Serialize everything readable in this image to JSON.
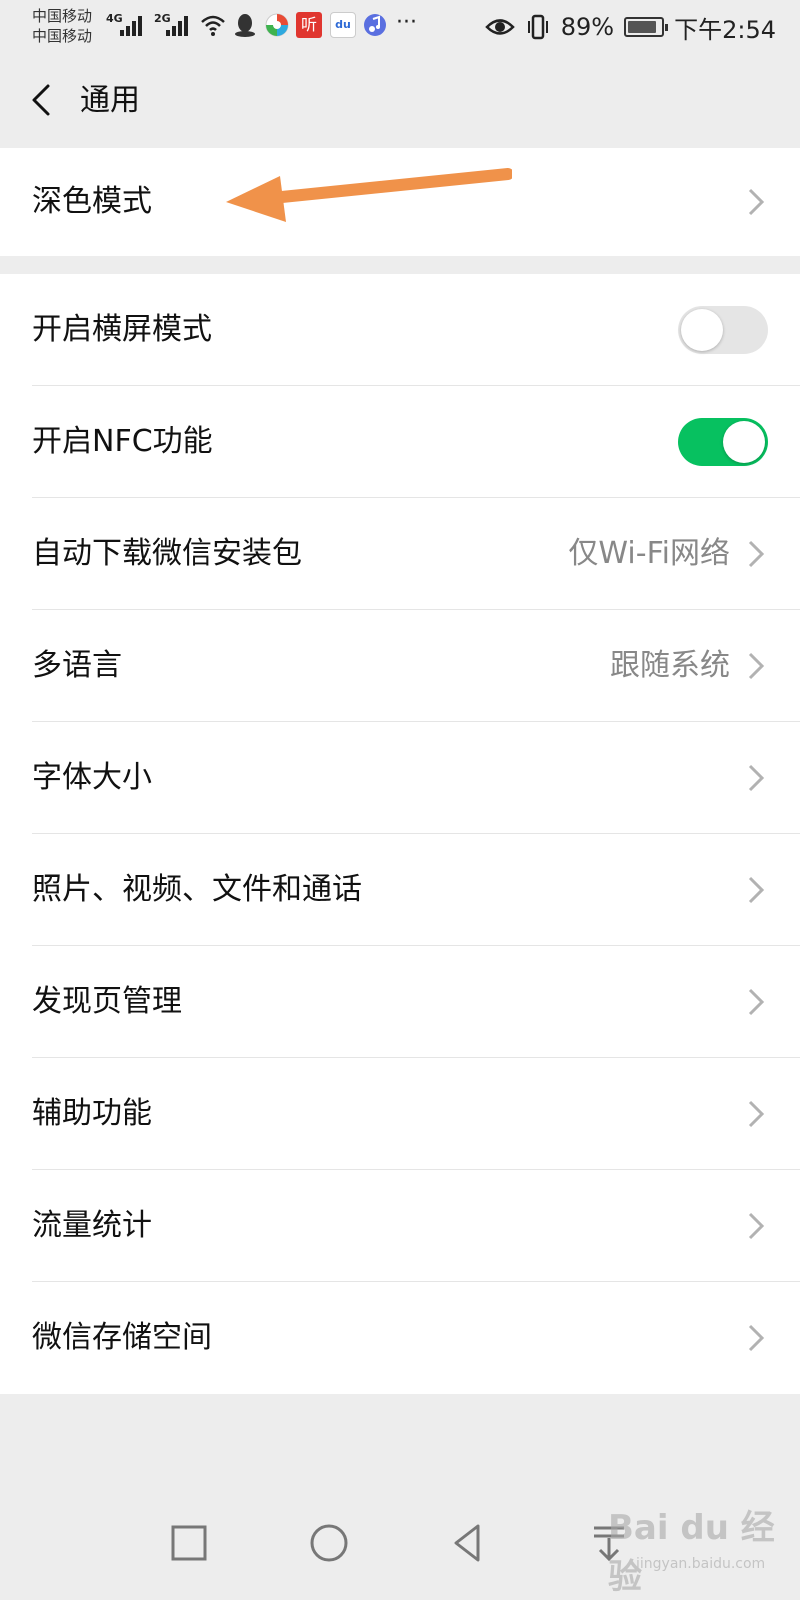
{
  "status_bar": {
    "carrier_1": "中国移动",
    "carrier_2": "中国移动",
    "network_1": "4G",
    "network_2": "2G",
    "notification_icons": [
      "wifi-icon",
      "qq-icon",
      "camera-app-icon",
      "ting-app-icon",
      "baidu-icon",
      "music-icon",
      "more-icon"
    ],
    "more": "···",
    "ting_label": "听",
    "baidu_label": "du",
    "battery_percent": "89%",
    "battery_level": 0.89,
    "time": "下午2:54"
  },
  "header": {
    "title": "通用"
  },
  "dark_mode_group": {
    "item": {
      "label": "深色模式"
    }
  },
  "settings": {
    "landscape": {
      "label": "开启横屏模式",
      "enabled": false
    },
    "nfc": {
      "label": "开启NFC功能",
      "enabled": true
    },
    "auto_download": {
      "label": "自动下载微信安装包",
      "value": "仅Wi-Fi网络"
    },
    "language": {
      "label": "多语言",
      "value": "跟随系统"
    },
    "font_size": {
      "label": "字体大小"
    },
    "media": {
      "label": "照片、视频、文件和通话"
    },
    "discover": {
      "label": "发现页管理"
    },
    "accessibility": {
      "label": "辅助功能"
    },
    "traffic": {
      "label": "流量统计"
    },
    "storage": {
      "label": "微信存储空间"
    }
  },
  "colors": {
    "toggle_on": "#07c160",
    "toggle_off": "#e5e5e5",
    "annotation_arrow": "#f0924a",
    "background": "#ededed"
  },
  "watermark": {
    "text": "Bai du 经验",
    "sub": "jingyan.baidu.com"
  }
}
